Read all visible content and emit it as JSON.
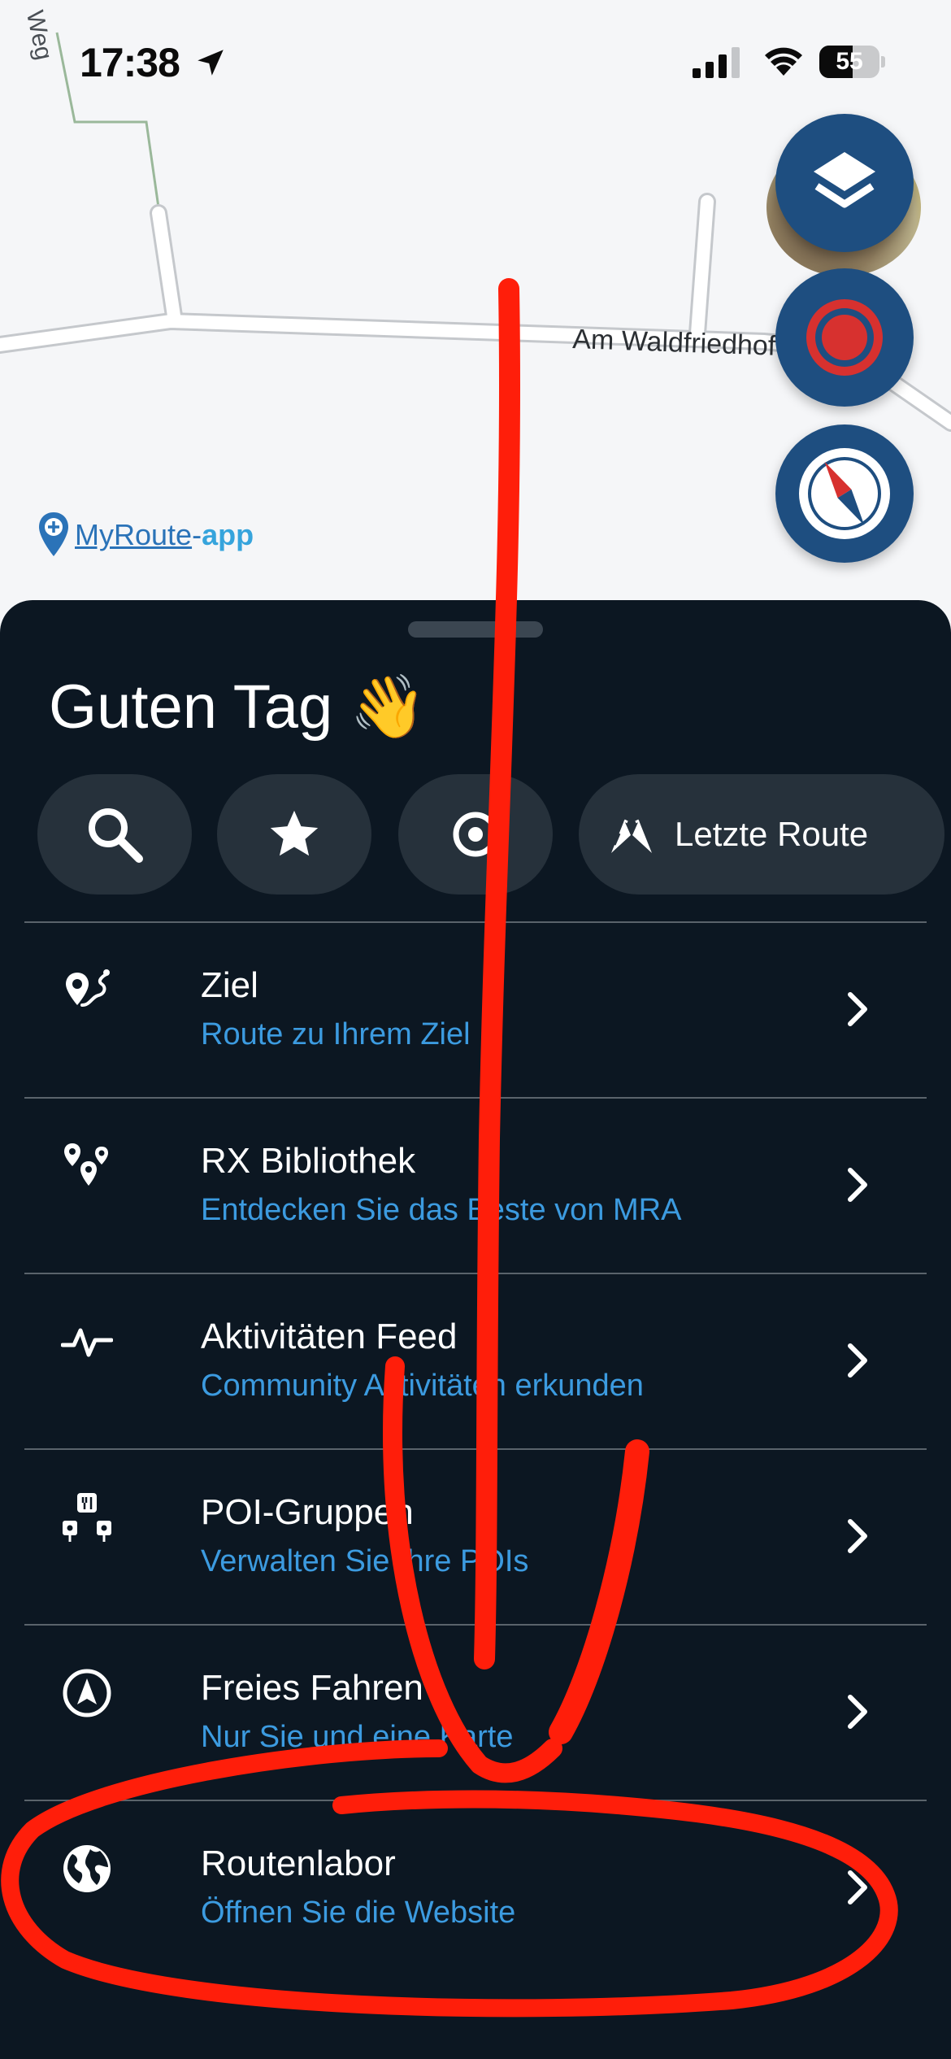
{
  "status_bar": {
    "time": "17:38",
    "battery_percent": 55,
    "battery_label": "55"
  },
  "map": {
    "street_label": "Am Waldfriedhof",
    "street_label_2": "Weg",
    "brand_name": "MyRoute",
    "brand_dash": "-",
    "brand_app": "app",
    "buttons": {
      "layers_icon": "layers-icon",
      "record_icon": "record-icon",
      "compass_icon": "compass-icon"
    }
  },
  "sheet": {
    "greeting": "Guten Tag 👋",
    "quick_actions": {
      "search_icon": "search-icon",
      "favorites_icon": "star-icon",
      "nearby_icon": "target-icon",
      "last_route_label": "Letzte Route",
      "last_route_icon": "flags-icon"
    },
    "menu": [
      {
        "title": "Ziel",
        "subtitle": "Route zu Ihrem Ziel",
        "icon": "destination-route-icon"
      },
      {
        "title": "RX Bibliothek",
        "subtitle": "Entdecken Sie das Beste von MRA",
        "icon": "map-pins-icon"
      },
      {
        "title": "Aktivitäten Feed",
        "subtitle": "Community Aktivitäten erkunden",
        "icon": "activity-pulse-icon"
      },
      {
        "title": "POI-Gruppen",
        "subtitle": "Verwalten Sie Ihre POIs",
        "icon": "poi-group-icon"
      },
      {
        "title": "Freies Fahren",
        "subtitle": "Nur Sie und eine Karte",
        "icon": "navigation-arrow-icon"
      },
      {
        "title": "Routenlabor",
        "subtitle": "Öffnen Sie die Website",
        "icon": "globe-icon"
      }
    ]
  },
  "colors": {
    "sheet_bg": "#0c1722",
    "accent_blue": "#3c9be0",
    "fab_blue": "#1e4e80",
    "annotation_red": "#ff1e0a"
  }
}
